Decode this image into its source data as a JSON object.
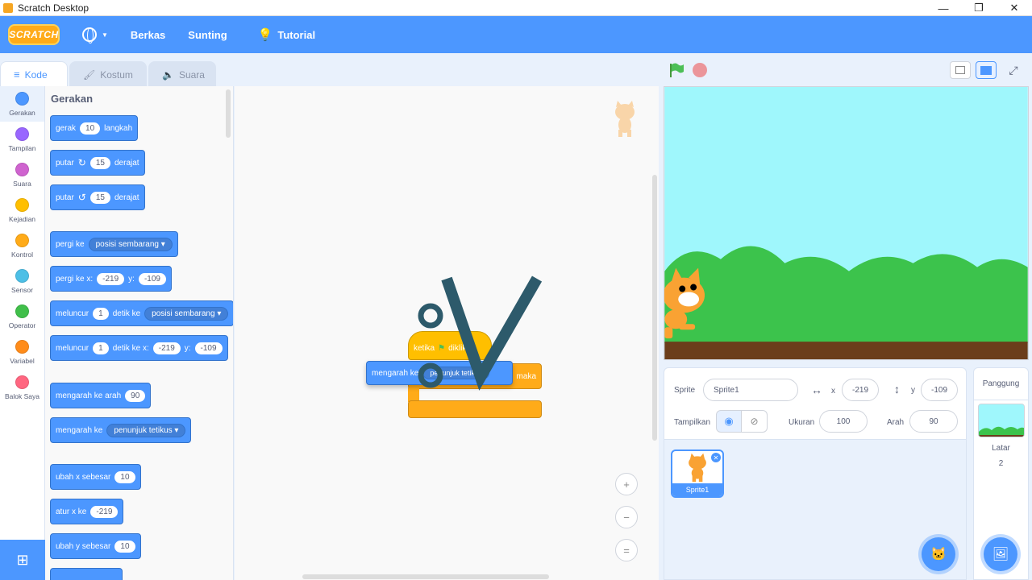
{
  "window": {
    "title": "Scratch Desktop",
    "controls": [
      "—",
      "❐",
      "✕"
    ]
  },
  "menubar": {
    "logo": "SCRATCH",
    "items": [
      "Berkas",
      "Sunting"
    ],
    "tutorial": "Tutorial"
  },
  "tabs": [
    {
      "label": "Kode",
      "icon": "code-icon"
    },
    {
      "label": "Kostum",
      "icon": "brush-icon"
    },
    {
      "label": "Suara",
      "icon": "speaker-icon"
    }
  ],
  "categories": [
    {
      "label": "Gerakan",
      "color": "#4c97ff"
    },
    {
      "label": "Tampilan",
      "color": "#9966ff"
    },
    {
      "label": "Suara",
      "color": "#cf63cf"
    },
    {
      "label": "Kejadian",
      "color": "#ffbf00"
    },
    {
      "label": "Kontrol",
      "color": "#ffab19"
    },
    {
      "label": "Sensor",
      "color": "#4cbfe6"
    },
    {
      "label": "Operator",
      "color": "#40bf4a"
    },
    {
      "label": "Variabel",
      "color": "#ff8c1a"
    },
    {
      "label": "Balok Saya",
      "color": "#ff6680"
    }
  ],
  "palette": {
    "section_title": "Gerakan",
    "blocks": {
      "gerak": {
        "pre": "gerak",
        "val": "10",
        "post": "langkah"
      },
      "putar_kanan": {
        "pre": "putar",
        "val": "15",
        "post": "derajat"
      },
      "putar_kiri": {
        "pre": "putar",
        "val": "15",
        "post": "derajat"
      },
      "pergi_ke": {
        "pre": "pergi ke",
        "dropdown": "posisi sembarang"
      },
      "pergi_xy": {
        "pre": "pergi ke x:",
        "x": "-219",
        "ylbl": "y:",
        "y": "-109"
      },
      "meluncur_ke": {
        "pre": "meluncur",
        "val": "1",
        "mid": "detik ke",
        "dropdown": "posisi sembarang"
      },
      "meluncur_xy": {
        "pre": "meluncur",
        "val": "1",
        "mid": "detik ke x:",
        "x": "-219",
        "ylbl": "y:",
        "y": "-109"
      },
      "arah": {
        "pre": "mengarah ke arah",
        "val": "90"
      },
      "mengarah_ke": {
        "pre": "mengarah ke",
        "dropdown": "penunjuk tetikus"
      },
      "ubah_x": {
        "pre": "ubah x sebesar",
        "val": "10"
      },
      "atur_x": {
        "pre": "atur x ke",
        "val": "-219"
      },
      "ubah_y": {
        "pre": "ubah y sebesar",
        "val": "10"
      }
    }
  },
  "script": {
    "hat_text": "ketika",
    "hat_suffix": "diklik",
    "if_text": "maka",
    "drag_text": "mengarah ke",
    "drag_suffix": "penunjuk tetikus"
  },
  "zoom": {
    "in": "+",
    "out": "−",
    "reset": "="
  },
  "sprite_info": {
    "sprite_label": "Sprite",
    "sprite_name": "Sprite1",
    "x_label": "x",
    "x": "-219",
    "y_label": "y",
    "y": "-109",
    "show_label": "Tampilkan",
    "size_label": "Ukuran",
    "size": "100",
    "direction_label": "Arah",
    "direction": "90"
  },
  "sprite_list": [
    {
      "name": "Sprite1"
    }
  ],
  "stage_pane": {
    "title": "Panggung",
    "backdrop_label": "Latar",
    "backdrop_count": "2"
  },
  "colors": {
    "motion": "#4c97ff",
    "events": "#ffbf00",
    "control": "#ffab19",
    "menu": "#4c97ff",
    "stage_sky": "#9ff7fc",
    "stage_grass": "#3cc34c",
    "stage_ground": "#6b3d1b"
  }
}
